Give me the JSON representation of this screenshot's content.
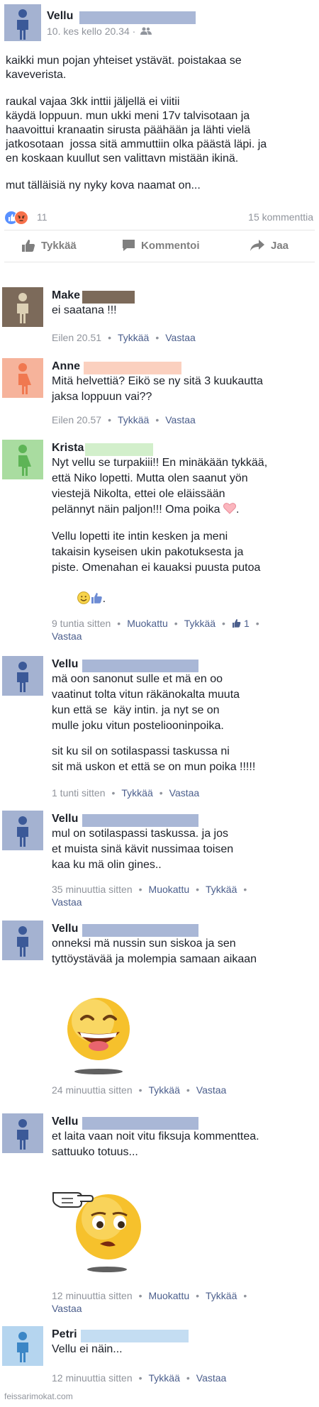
{
  "post": {
    "author": "Vellu",
    "timestamp": "10. kes kello 20.34 ·",
    "audience_icon": "friends-icon",
    "paragraphs": [
      "kaikki mun pojan yhteiset ystävät. poistakaa se\nkaveverista.",
      "raukal vajaa 3kk inttii jäljellä ei viitii\nkäydä loppuun. mun ukki meni 17v talvisotaan ja\nhaavoittui kranaatin sirusta päähään ja lähti vielä\njatkosotaan  jossa sitä ammuttiin olka päästä läpi. ja\nen koskaan kuullut sen valittavn mistään ikinä.",
      "mut tälläisiä ny nyky kova naamat on..."
    ],
    "reaction_icons": [
      "like-icon",
      "angry-icon"
    ],
    "reaction_count": "11",
    "comment_count": "15 kommenttia",
    "colors": {
      "like": "#5890ff",
      "angry": "#f7714b",
      "link": "#4b5e8c",
      "meta": "#90949c",
      "redaction": "#a9b7d6"
    }
  },
  "actions": {
    "like": "Tykkää",
    "comment": "Kommentoi",
    "share": "Jaa"
  },
  "comments": [
    {
      "author": "Make",
      "paragraphs": [
        "ei saatana !!!"
      ],
      "time": "Eilen 20.51",
      "links": [
        "Tykkää",
        "Vastaa"
      ]
    },
    {
      "author": "Anne",
      "paragraphs": [
        "Mitä helvettiä? Eikö se ny sitä 3 kuukautta\njaksa loppuun vai??"
      ],
      "time": "Eilen 20.57",
      "links": [
        "Tykkää",
        "Vastaa"
      ]
    },
    {
      "author": "Krista",
      "paragraphs": [
        "Nyt vellu se turpakiii!! En minäkään tykkää,\nettä Niko lopetti. Mutta olen saanut yön\nviestejä Nikolta, ettei ole eläissään\npelännyt näin paljon!!! Oma poika",
        "Vellu lopetti ite intin kesken ja meni\ntakaisin kyseisen ukin pakotuksesta ja\npiste. Omenahan ei kauaksi puusta putoa"
      ],
      "time": "9 tuntia sitten",
      "links": [
        "Muokattu",
        "Tykkää",
        "1",
        "Vastaa"
      ]
    },
    {
      "author": "Vellu",
      "paragraphs": [
        "mä oon sanonut sulle et mä en oo\nvaatinut tolta vitun räkänokalta muuta\nkun että se  käy intin. ja nyt se on\nmulle joku vitun posteliooninpoika.",
        "sit ku sil on sotilaspassi taskussa ni\nsit mä uskon et että se on mun poika !!!!!"
      ],
      "time": "1 tunti sitten",
      "links": [
        "Tykkää",
        "Vastaa"
      ]
    },
    {
      "author": "Vellu",
      "paragraphs": [
        "mul on sotilaspassi taskussa. ja jos\net muista sinä kävit nussimaa toisen\nkaa ku mä olin gines.."
      ],
      "time": "35 minuuttia sitten",
      "links": [
        "Muokattu",
        "Tykkää",
        "Vastaa"
      ]
    },
    {
      "author": "Vellu",
      "paragraphs": [
        "onneksi mä nussin sun siskoa ja sen\ntyttöystävää ja molempia samaan aikaan"
      ],
      "time": "24 minuuttia sitten",
      "links": [
        "Tykkää",
        "Vastaa"
      ]
    },
    {
      "author": "Vellu",
      "paragraphs": [
        "et laita vaan noit vitu fiksuja kommenttea.\nsattuuko totuus..."
      ],
      "time": "12 minuuttia sitten",
      "links": [
        "Muokattu",
        "Tykkää",
        "Vastaa"
      ]
    },
    {
      "author": "Petri",
      "paragraphs": [
        "Vellu ei näin..."
      ],
      "time": "12 minuuttia sitten",
      "links": [
        "Tykkää",
        "Vastaa"
      ]
    }
  ],
  "watermark": "feissarimokat.com"
}
